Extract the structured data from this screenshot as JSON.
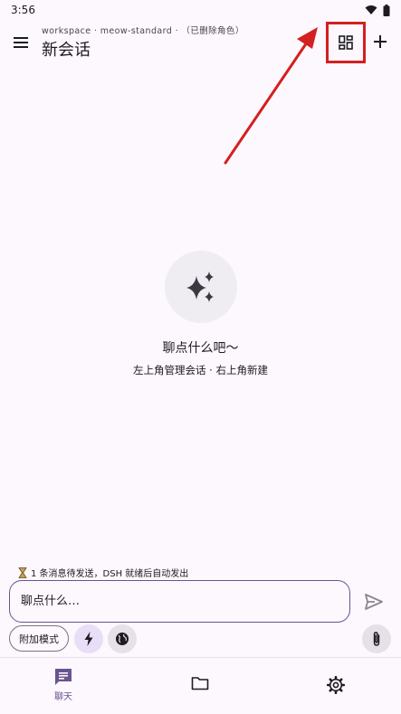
{
  "status_bar": {
    "time": "3:56"
  },
  "header": {
    "subtitle": "workspace · meow-standard · （已删除角色）",
    "title": "新会话"
  },
  "empty_state": {
    "title": "聊点什么吧～",
    "hint": "左上角管理会话 · 右上角新建"
  },
  "queue_status": {
    "text": "1 条消息待发送，DSH 就绪后自动发出"
  },
  "composer": {
    "placeholder": "聊点什么…",
    "mode_chip_label": "附加模式"
  },
  "bottom_nav": {
    "items": [
      {
        "label": "聊天",
        "icon": "chat-icon",
        "active": true
      },
      {
        "label": "",
        "icon": "folder-icon",
        "active": false
      },
      {
        "label": "",
        "icon": "gear-icon",
        "active": false
      }
    ]
  },
  "colors": {
    "background": "#fdf7fe",
    "accent": "#6a5490",
    "highlight_box": "#d32020",
    "annotation_arrow": "#d32020"
  }
}
